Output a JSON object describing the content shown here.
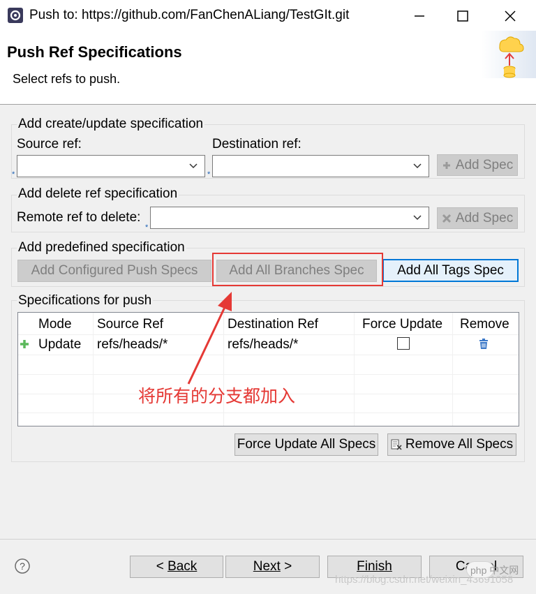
{
  "window": {
    "title": "Push to: https://github.com/FanChenALiang/TestGIt.git"
  },
  "header": {
    "title": "Push Ref Specifications",
    "subtitle": "Select refs to push."
  },
  "create_update": {
    "group_title": "Add create/update specification",
    "source_label": "Source ref:",
    "source_value": "",
    "destination_label": "Destination ref:",
    "destination_value": "",
    "add_spec_label": "Add Spec"
  },
  "delete_ref": {
    "group_title": "Add delete ref specification",
    "remote_label": "Remote ref to delete:",
    "remote_value": "",
    "add_spec_label": "Add Spec"
  },
  "predefined": {
    "group_title": "Add predefined specification",
    "configured_label": "Add Configured Push Specs",
    "branches_label": "Add All Branches Spec",
    "tags_label": "Add All Tags Spec"
  },
  "specs": {
    "group_title": "Specifications for push",
    "columns": [
      "Mode",
      "Source Ref",
      "Destination Ref",
      "Force Update",
      "Remove"
    ],
    "rows": [
      {
        "mode": "Update",
        "source": "refs/heads/*",
        "destination": "refs/heads/*",
        "force_update": false
      }
    ],
    "force_update_all_label": "Force Update All Specs",
    "remove_all_label": "Remove All Specs"
  },
  "annotation": {
    "text": "将所有的分支都加入"
  },
  "footer": {
    "back_label": "Back",
    "next_label": "Next",
    "finish_label": "Finish",
    "cancel_label": "Cancel",
    "watermark": "https://blog.csdn.net/weixin_43691058",
    "badge_text": "php 中文网"
  },
  "colors": {
    "annotation": "#e53935",
    "focus_border": "#0078d7",
    "add_icon": "#5cb85c",
    "trash_icon": "#3b78c8"
  },
  "icons": [
    "eclipse-app-icon",
    "minimize-icon",
    "maximize-icon",
    "close-icon",
    "cloud-push-icon",
    "chevron-down-icon",
    "plus-icon",
    "delete-x-icon",
    "add-row-icon",
    "trash-icon",
    "remove-all-icon",
    "help-icon"
  ]
}
